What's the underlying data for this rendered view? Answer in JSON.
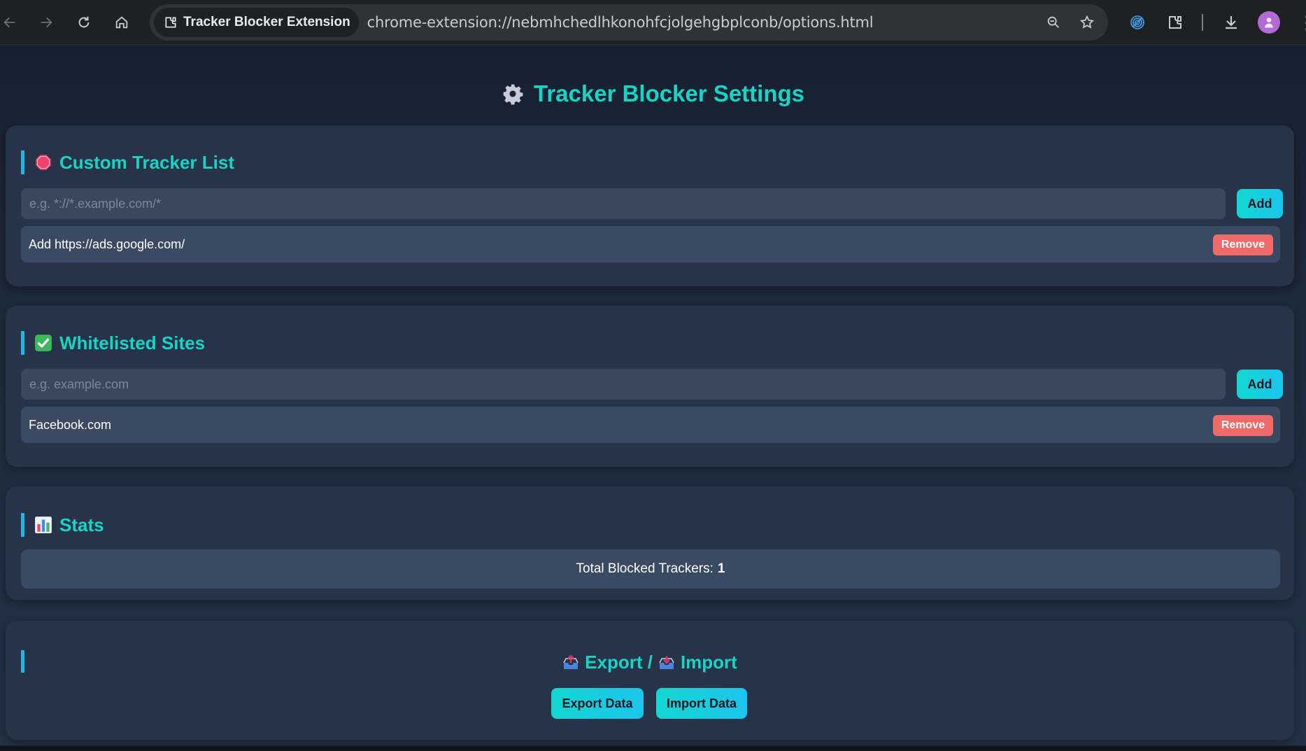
{
  "browser": {
    "tab_chip_label": "Tracker Blocker Extension",
    "url": "chrome-extension://nebmhchedlhkonohfcjolgehgbplconb/options.html",
    "icons": [
      "back-icon",
      "forward-icon",
      "reload-icon",
      "home-icon",
      "zoom-icon",
      "bookmark-star-icon",
      "tracker-extension-icon",
      "extensions-puzzle-icon",
      "download-icon",
      "profile-avatar-icon",
      "more-menu-icon"
    ]
  },
  "page": {
    "title": "Tracker Blocker Settings",
    "custom_trackers": {
      "heading": "Custom Tracker List",
      "input_placeholder": "e.g. *://*.example.com/*",
      "add_label": "Add",
      "items": [
        {
          "text": "Add https://ads.google.com/",
          "remove_label": "Remove"
        }
      ]
    },
    "whitelist": {
      "heading": "Whitelisted Sites",
      "input_placeholder": "e.g. example.com",
      "add_label": "Add",
      "items": [
        {
          "text": "Facebook.com",
          "remove_label": "Remove"
        }
      ]
    },
    "stats": {
      "heading": "Stats",
      "label": "Total Blocked Trackers:",
      "value": "1"
    },
    "export_import": {
      "export_heading": "Export /",
      "import_heading": "Import",
      "export_button": "Export Data",
      "import_button": "Import Data"
    }
  },
  "colors": {
    "accent": "#19d3c5",
    "button_gradient_start": "#12d7d0",
    "button_gradient_end": "#1cc4ec",
    "remove": "#f06a6a",
    "card": "#263349",
    "page_bg": "#1b2435"
  }
}
